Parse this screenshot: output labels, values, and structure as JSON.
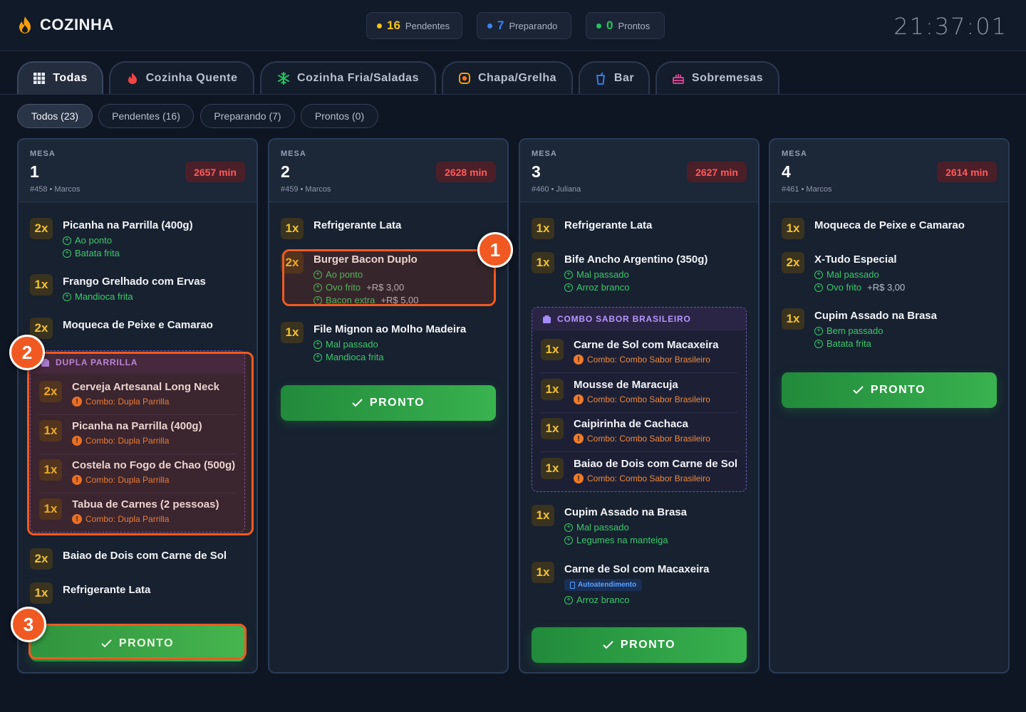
{
  "brand": {
    "name": "COZINHA"
  },
  "stats": [
    {
      "num": "16",
      "label": "Pendentes",
      "color": "#f5c518"
    },
    {
      "num": "7",
      "label": "Preparando",
      "color": "#3b82f6"
    },
    {
      "num": "0",
      "label": "Prontos",
      "color": "#22c55e"
    }
  ],
  "clock": "21:37:01",
  "tabs": [
    {
      "label": "Todas",
      "icon": "grid-icon"
    },
    {
      "label": "Cozinha Quente",
      "icon": "flame-icon"
    },
    {
      "label": "Cozinha Fria/Saladas",
      "icon": "snowflake-icon"
    },
    {
      "label": "Chapa/Grelha",
      "icon": "grill-icon"
    },
    {
      "label": "Bar",
      "icon": "cup-icon"
    },
    {
      "label": "Sobremesas",
      "icon": "cake-icon"
    }
  ],
  "filters": [
    "Todos (23)",
    "Pendentes (16)",
    "Preparando (7)",
    "Prontos (0)"
  ],
  "mesa_label": "MESA",
  "pronto_label": "PRONTO",
  "orders": [
    {
      "mesa": "1",
      "meta": "#458 • Marcos",
      "timer": "2657 min",
      "items": [
        {
          "qty": "2x",
          "name": "Picanha na Parrilla (400g)",
          "mods": [
            "Ao ponto",
            "Batata frita"
          ]
        },
        {
          "qty": "1x",
          "name": "Frango Grelhado com Ervas",
          "mods": [
            "Mandioca frita"
          ]
        },
        {
          "qty": "2x",
          "name": "Moqueca de Peixe e Camarao",
          "mods": []
        }
      ],
      "combo": {
        "title": "DUPLA PARRILLA",
        "items": [
          {
            "qty": "2x",
            "name": "Cerveja Artesanal Long Neck",
            "note": "Combo: Dupla Parrilla"
          },
          {
            "qty": "1x",
            "name": "Picanha na Parrilla (400g)",
            "note": "Combo: Dupla Parrilla"
          },
          {
            "qty": "1x",
            "name": "Costela no Fogo de Chao (500g)",
            "note": "Combo: Dupla Parrilla"
          },
          {
            "qty": "1x",
            "name": "Tabua de Carnes (2 pessoas)",
            "note": "Combo: Dupla Parrilla"
          }
        ]
      },
      "after": [
        {
          "qty": "2x",
          "name": "Baiao de Dois com Carne de Sol"
        },
        {
          "qty": "1x",
          "name": "Refrigerante Lata"
        }
      ]
    },
    {
      "mesa": "2",
      "meta": "#459 • Marcos",
      "timer": "2628 min",
      "items": [
        {
          "qty": "1x",
          "name": "Refrigerante Lata",
          "mods": []
        },
        {
          "qty": "2x",
          "name": "Burger Bacon Duplo",
          "mods": [
            {
              "text": "Ao ponto",
              "price": ""
            },
            {
              "text": "Ovo frito",
              "price": "+R$ 3,00"
            },
            {
              "text": "Bacon extra",
              "price": "+R$ 5,00"
            }
          ]
        },
        {
          "qty": "1x",
          "name": "File Mignon ao Molho Madeira",
          "mods": [
            "Mal passado",
            "Mandioca frita"
          ]
        }
      ]
    },
    {
      "mesa": "3",
      "meta": "#460 • Juliana",
      "timer": "2627 min",
      "items": [
        {
          "qty": "1x",
          "name": "Refrigerante Lata",
          "mods": []
        },
        {
          "qty": "1x",
          "name": "Bife Ancho Argentino (350g)",
          "mods": [
            "Mal passado",
            "Arroz branco"
          ]
        }
      ],
      "combo": {
        "title": "COMBO SABOR BRASILEIRO",
        "items": [
          {
            "qty": "1x",
            "name": "Carne de Sol com Macaxeira",
            "note": "Combo: Combo Sabor Brasileiro"
          },
          {
            "qty": "1x",
            "name": "Mousse de Maracuja",
            "note": "Combo: Combo Sabor Brasileiro"
          },
          {
            "qty": "1x",
            "name": "Caipirinha de Cachaca",
            "note": "Combo: Combo Sabor Brasileiro"
          },
          {
            "qty": "1x",
            "name": "Baiao de Dois com Carne de Sol",
            "note": "Combo: Combo Sabor Brasileiro"
          }
        ]
      },
      "after": [
        {
          "qty": "1x",
          "name": "Cupim Assado na Brasa",
          "mods": [
            "Mal passado",
            "Legumes na manteiga"
          ]
        },
        {
          "qty": "1x",
          "name": "Carne de Sol com Macaxeira",
          "tag": "Autoatendimento",
          "mods": [
            "Arroz branco"
          ]
        }
      ]
    },
    {
      "mesa": "4",
      "meta": "#461 • Marcos",
      "timer": "2614 min",
      "items": [
        {
          "qty": "1x",
          "name": "Moqueca de Peixe e Camarao",
          "mods": []
        },
        {
          "qty": "2x",
          "name": "X-Tudo Especial",
          "mods": [
            {
              "text": "Mal passado",
              "price": ""
            },
            {
              "text": "Ovo frito",
              "price": "+R$ 3,00"
            }
          ]
        },
        {
          "qty": "1x",
          "name": "Cupim Assado na Brasa",
          "mods": [
            "Bem passado",
            "Batata frita"
          ]
        }
      ]
    }
  ],
  "annotations": [
    "1",
    "2",
    "3"
  ]
}
